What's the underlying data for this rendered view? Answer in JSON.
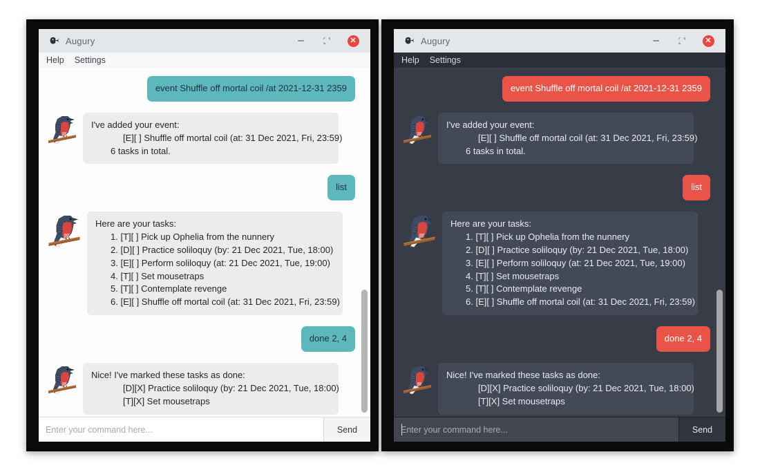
{
  "app": {
    "title": "Augury",
    "logo_icon": "bird-swallow-icon"
  },
  "titlebar": {
    "minimize_icon": "minimize-icon",
    "maximize_icon": "maximize-restore-icon",
    "close_icon": "close-icon",
    "close_glyph": "✕"
  },
  "menubar": {
    "items": [
      {
        "label": "Help"
      },
      {
        "label": "Settings"
      }
    ]
  },
  "conversation": [
    {
      "role": "user",
      "text": "event Shuffle off mortal coil /at 2021-12-31 2359"
    },
    {
      "role": "bot",
      "lines": [
        {
          "text": "I've added your event:",
          "indent": 0
        },
        {
          "text": "[E][ ] Shuffle off mortal coil (at: 31 Dec 2021, Fri, 23:59)",
          "indent": 1
        },
        {
          "text": "6 tasks in total.",
          "indent": 2
        }
      ]
    },
    {
      "role": "user",
      "text": "list"
    },
    {
      "role": "bot",
      "lines": [
        {
          "text": "Here are your tasks:",
          "indent": 0
        },
        {
          "text": "1. [T][ ] Pick up Ophelia from the nunnery",
          "indent": 3
        },
        {
          "text": "2. [D][ ] Practice soliloquy (by: 21 Dec 2021, Tue, 18:00)",
          "indent": 3
        },
        {
          "text": "3. [E][ ] Perform soliloquy (at: 21 Dec 2021, Tue, 19:00)",
          "indent": 3
        },
        {
          "text": "4. [T][ ] Set mousetraps",
          "indent": 3
        },
        {
          "text": "5. [T][ ] Contemplate revenge",
          "indent": 3
        },
        {
          "text": "6. [E][ ] Shuffle off mortal coil (at: 31 Dec 2021, Fri, 23:59)",
          "indent": 3
        }
      ]
    },
    {
      "role": "user",
      "text": "done 2, 4"
    },
    {
      "role": "bot",
      "lines": [
        {
          "text": "Nice! I've marked these tasks as done:",
          "indent": 0
        },
        {
          "text": "[D][X] Practice soliloquy (by: 21 Dec 2021, Tue, 18:00)",
          "indent": 1
        },
        {
          "text": "[T][X] Set mousetraps",
          "indent": 1
        }
      ]
    }
  ],
  "input": {
    "placeholder": "Enter your command here...",
    "value": "",
    "send_label": "Send"
  },
  "themes": {
    "light": {
      "name": "light",
      "user_bubble": "#5cb8bd",
      "bot_bubble": "#ececec",
      "chat_background": "#fdfdfd",
      "menubar_background": "#f7f7f7",
      "scrollbar_thumb": "#b4b4b4"
    },
    "dark": {
      "name": "dark",
      "user_bubble": "#ea5448",
      "bot_bubble": "#434956",
      "chat_background": "#383c47",
      "menubar_background": "#2b2f3a",
      "scrollbar_thumb": "#a6a6a6"
    }
  },
  "titlebar_background": "#e4e7ea",
  "close_button_color": "#e8453c",
  "page_background": "#ffffff",
  "frame_color": "#0a0a0a"
}
